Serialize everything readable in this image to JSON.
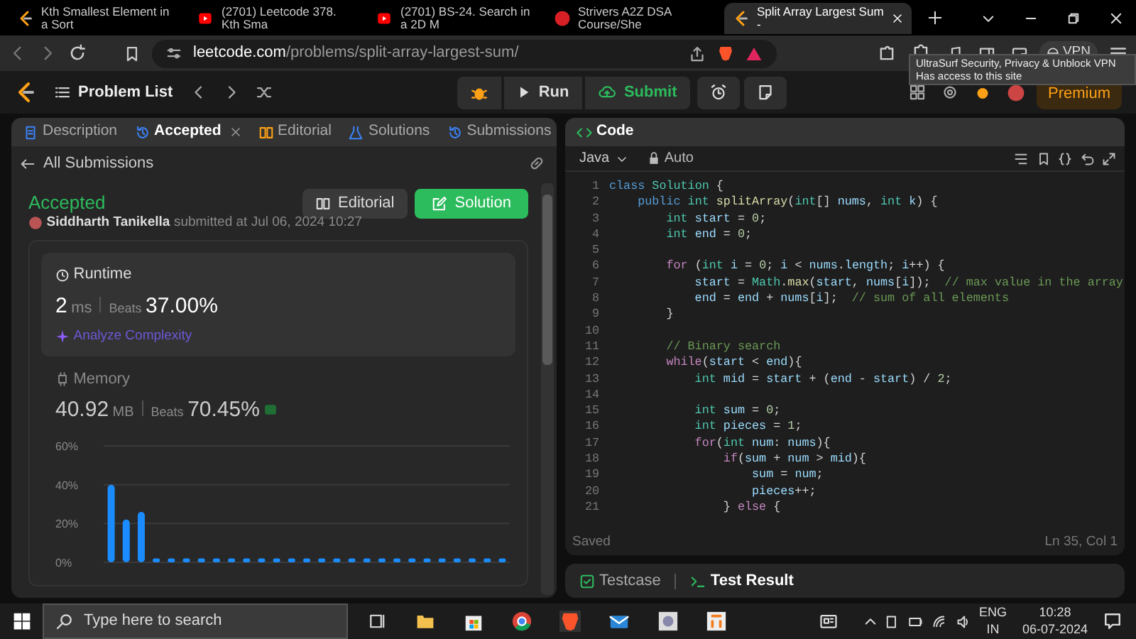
{
  "browser_tabs": [
    {
      "title": "Kth Smallest Element in a Sort",
      "kind": "leetcode",
      "selected": false
    },
    {
      "title": "(2701) Leetcode 378. Kth Sma",
      "kind": "youtube",
      "selected": false
    },
    {
      "title": "(2701) BS-24. Search in a 2D M",
      "kind": "youtube",
      "selected": false
    },
    {
      "title": "Strivers A2Z DSA Course/She",
      "kind": "site",
      "selected": false
    },
    {
      "title": "Split Array Largest Sum -",
      "kind": "leetcode",
      "selected": true
    }
  ],
  "address_bar": {
    "host": "leetcode.com",
    "path": "/problems/split-array-largest-sum/"
  },
  "vpn_label": "VPN",
  "tooltip": {
    "title": "UltraSurf Security, Privacy & Unblock VPN",
    "subtitle": "Has access to this site"
  },
  "header": {
    "problem_list": "Problem List",
    "run": "Run",
    "submit": "Submit",
    "premium": "Premium"
  },
  "left_tabs": [
    {
      "label": "Description",
      "selected": false,
      "closable": false
    },
    {
      "label": "Accepted",
      "selected": true,
      "closable": true
    },
    {
      "label": "Editorial",
      "selected": false,
      "closable": false
    },
    {
      "label": "Solutions",
      "selected": false,
      "closable": false
    },
    {
      "label": "Submissions",
      "selected": false,
      "closable": false
    }
  ],
  "back_link": "All Submissions",
  "submission": {
    "status": "Accepted",
    "user": "Siddharth Tanikella",
    "submitted": "submitted at Jul 06, 2024 10:27",
    "editorial_button": "Editorial",
    "solution_button": "Solution"
  },
  "runtime": {
    "label": "Runtime",
    "value": "2",
    "unit": "ms",
    "beats_label": "Beats",
    "beats": "37.00%",
    "analyze": "Analyze Complexity"
  },
  "memory": {
    "label": "Memory",
    "value": "40.92",
    "unit": "MB",
    "beats_label": "Beats",
    "beats": "70.45%"
  },
  "chart_data": {
    "type": "bar",
    "ylim": [
      0,
      60
    ],
    "yticks": [
      {
        "value": 0,
        "label": "0%"
      },
      {
        "value": 20,
        "label": "20%"
      },
      {
        "value": 40,
        "label": "40%"
      },
      {
        "value": 60,
        "label": "60%"
      }
    ],
    "values": [
      40,
      22,
      26,
      2,
      2,
      2,
      2,
      2,
      2,
      2,
      2,
      2,
      2,
      2,
      2,
      2,
      2,
      2,
      2,
      2,
      2,
      2,
      2,
      2,
      2,
      2,
      2
    ]
  },
  "editor": {
    "title": "Code",
    "language": "Java",
    "mode": "Auto",
    "status": "Saved",
    "cursor": "Ln 35, Col 1",
    "lines": [
      {
        "number": "1",
        "tokens": [
          {
            "kind": "kw",
            "text": "class"
          },
          {
            "kind": "ty",
            "text": " Solution"
          },
          {
            "kind": "p",
            "text": " {"
          }
        ]
      },
      {
        "number": "2",
        "tokens": [
          {
            "kind": "kw",
            "text": "    public"
          },
          {
            "kind": "ty",
            "text": " int"
          },
          {
            "kind": "fn",
            "text": " splitArray"
          },
          {
            "kind": "p",
            "text": "("
          },
          {
            "kind": "ty",
            "text": "int"
          },
          {
            "kind": "p",
            "text": "[] "
          },
          {
            "kind": "v",
            "text": "nums"
          },
          {
            "kind": "p",
            "text": ", "
          },
          {
            "kind": "ty",
            "text": "int"
          },
          {
            "kind": "v",
            "text": " k"
          },
          {
            "kind": "p",
            "text": ") {"
          }
        ]
      },
      {
        "number": "3",
        "tokens": [
          {
            "kind": "ty",
            "text": "        int"
          },
          {
            "kind": "v",
            "text": " start"
          },
          {
            "kind": "p",
            "text": " = "
          },
          {
            "kind": "n",
            "text": "0"
          },
          {
            "kind": "p",
            "text": ";"
          }
        ]
      },
      {
        "number": "4",
        "tokens": [
          {
            "kind": "ty",
            "text": "        int"
          },
          {
            "kind": "v",
            "text": " end"
          },
          {
            "kind": "p",
            "text": " = "
          },
          {
            "kind": "n",
            "text": "0"
          },
          {
            "kind": "p",
            "text": ";"
          }
        ]
      },
      {
        "number": "5"
      },
      {
        "number": "6",
        "tokens": [
          {
            "kind": "ctl",
            "text": "        for"
          },
          {
            "kind": "p",
            "text": " ("
          },
          {
            "kind": "ty",
            "text": "int"
          },
          {
            "kind": "v",
            "text": " i"
          },
          {
            "kind": "p",
            "text": " = "
          },
          {
            "kind": "n",
            "text": "0"
          },
          {
            "kind": "p",
            "text": "; "
          },
          {
            "kind": "v",
            "text": "i"
          },
          {
            "kind": "p",
            "text": " < "
          },
          {
            "kind": "v",
            "text": "nums"
          },
          {
            "kind": "p",
            "text": "."
          },
          {
            "kind": "v",
            "text": "length"
          },
          {
            "kind": "p",
            "text": "; "
          },
          {
            "kind": "v",
            "text": "i"
          },
          {
            "kind": "p",
            "text": "++) {"
          }
        ]
      },
      {
        "number": "7",
        "tokens": [
          {
            "kind": "v",
            "text": "            start"
          },
          {
            "kind": "p",
            "text": " = "
          },
          {
            "kind": "ty",
            "text": "Math"
          },
          {
            "kind": "p",
            "text": "."
          },
          {
            "kind": "fn",
            "text": "max"
          },
          {
            "kind": "p",
            "text": "("
          },
          {
            "kind": "v",
            "text": "start"
          },
          {
            "kind": "p",
            "text": ", "
          },
          {
            "kind": "v",
            "text": "nums"
          },
          {
            "kind": "p",
            "text": "["
          },
          {
            "kind": "v",
            "text": "i"
          },
          {
            "kind": "p",
            "text": "]);  "
          },
          {
            "kind": "c",
            "text": "// max value in the array"
          }
        ]
      },
      {
        "number": "8",
        "tokens": [
          {
            "kind": "v",
            "text": "            end"
          },
          {
            "kind": "p",
            "text": " = "
          },
          {
            "kind": "v",
            "text": "end"
          },
          {
            "kind": "p",
            "text": " + "
          },
          {
            "kind": "v",
            "text": "nums"
          },
          {
            "kind": "p",
            "text": "["
          },
          {
            "kind": "v",
            "text": "i"
          },
          {
            "kind": "p",
            "text": "];  "
          },
          {
            "kind": "c",
            "text": "// sum of all elements"
          }
        ]
      },
      {
        "number": "9",
        "tokens": [
          {
            "kind": "p",
            "text": "        }"
          }
        ]
      },
      {
        "number": "10"
      },
      {
        "number": "11",
        "tokens": [
          {
            "kind": "c",
            "text": "        // Binary search"
          }
        ]
      },
      {
        "number": "12",
        "tokens": [
          {
            "kind": "ctl",
            "text": "        while"
          },
          {
            "kind": "p",
            "text": "("
          },
          {
            "kind": "v",
            "text": "start"
          },
          {
            "kind": "p",
            "text": " < "
          },
          {
            "kind": "v",
            "text": "end"
          },
          {
            "kind": "p",
            "text": "){"
          }
        ]
      },
      {
        "number": "13",
        "tokens": [
          {
            "kind": "ty",
            "text": "            int"
          },
          {
            "kind": "v",
            "text": " mid"
          },
          {
            "kind": "p",
            "text": " = "
          },
          {
            "kind": "v",
            "text": "start"
          },
          {
            "kind": "p",
            "text": " + ("
          },
          {
            "kind": "v",
            "text": "end"
          },
          {
            "kind": "p",
            "text": " - "
          },
          {
            "kind": "v",
            "text": "start"
          },
          {
            "kind": "p",
            "text": ") / "
          },
          {
            "kind": "n",
            "text": "2"
          },
          {
            "kind": "p",
            "text": ";"
          }
        ]
      },
      {
        "number": "14"
      },
      {
        "number": "15",
        "tokens": [
          {
            "kind": "ty",
            "text": "            int"
          },
          {
            "kind": "v",
            "text": " sum"
          },
          {
            "kind": "p",
            "text": " = "
          },
          {
            "kind": "n",
            "text": "0"
          },
          {
            "kind": "p",
            "text": ";"
          }
        ]
      },
      {
        "number": "16",
        "tokens": [
          {
            "kind": "ty",
            "text": "            int"
          },
          {
            "kind": "v",
            "text": " pieces"
          },
          {
            "kind": "p",
            "text": " = "
          },
          {
            "kind": "n",
            "text": "1"
          },
          {
            "kind": "p",
            "text": ";"
          }
        ]
      },
      {
        "number": "17",
        "tokens": [
          {
            "kind": "ctl",
            "text": "            for"
          },
          {
            "kind": "p",
            "text": "("
          },
          {
            "kind": "ty",
            "text": "int"
          },
          {
            "kind": "v",
            "text": " num"
          },
          {
            "kind": "p",
            "text": ": "
          },
          {
            "kind": "v",
            "text": "nums"
          },
          {
            "kind": "p",
            "text": "){"
          }
        ]
      },
      {
        "number": "18",
        "tokens": [
          {
            "kind": "ctl",
            "text": "                if"
          },
          {
            "kind": "p",
            "text": "("
          },
          {
            "kind": "v",
            "text": "sum"
          },
          {
            "kind": "p",
            "text": " + "
          },
          {
            "kind": "v",
            "text": "num"
          },
          {
            "kind": "p",
            "text": " > "
          },
          {
            "kind": "v",
            "text": "mid"
          },
          {
            "kind": "p",
            "text": "){"
          }
        ]
      },
      {
        "number": "19",
        "tokens": [
          {
            "kind": "v",
            "text": "                    sum"
          },
          {
            "kind": "p",
            "text": " = "
          },
          {
            "kind": "v",
            "text": "num"
          },
          {
            "kind": "p",
            "text": ";"
          }
        ]
      },
      {
        "number": "20",
        "tokens": [
          {
            "kind": "v",
            "text": "                    pieces"
          },
          {
            "kind": "p",
            "text": "++;"
          }
        ]
      },
      {
        "number": "21",
        "tokens": [
          {
            "kind": "p",
            "text": "                } "
          },
          {
            "kind": "ctl",
            "text": "else"
          },
          {
            "kind": "p",
            "text": " {"
          }
        ]
      }
    ]
  },
  "bottom_tabs": [
    {
      "label": "Testcase",
      "selected": false
    },
    {
      "label": "Test Result",
      "selected": true
    }
  ],
  "taskbar": {
    "search_placeholder": "Type here to search",
    "lang": "ENG",
    "region": "IN",
    "time": "10:28",
    "date": "06-07-2024"
  }
}
